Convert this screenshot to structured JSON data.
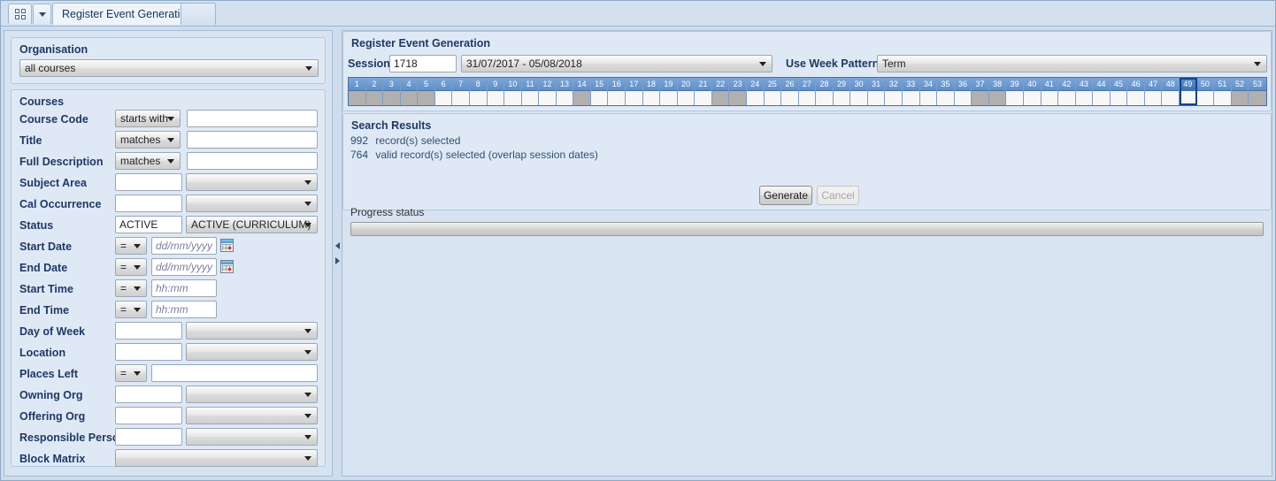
{
  "tabbar": {
    "grid_icon": "grid-icon",
    "menu_icon": "chevron-down-icon",
    "active_tab": "Register Event Generation",
    "empty_tab": ""
  },
  "left": {
    "organisation": {
      "title": "Organisation",
      "value": "all courses"
    },
    "courses": {
      "title": "Courses",
      "rows": [
        {
          "label": "Course Code",
          "op": "starts with",
          "type": "op-text",
          "value": ""
        },
        {
          "label": "Title",
          "op": "matches",
          "type": "op-text",
          "value": ""
        },
        {
          "label": "Full Description",
          "op": "matches",
          "type": "op-text",
          "value": ""
        },
        {
          "label": "Subject Area",
          "type": "text-combo",
          "value": "",
          "combo": ""
        },
        {
          "label": "Cal Occurrence",
          "type": "text-combo",
          "value": "",
          "combo": ""
        },
        {
          "label": "Status",
          "type": "text-combo",
          "value": "ACTIVE",
          "combo": "ACTIVE (CURRICULUM)"
        },
        {
          "label": "Start Date",
          "op": "=",
          "type": "date",
          "value": "",
          "placeholder": "dd/mm/yyyy"
        },
        {
          "label": "End Date",
          "op": "=",
          "type": "date",
          "value": "",
          "placeholder": "dd/mm/yyyy"
        },
        {
          "label": "Start Time",
          "op": "=",
          "type": "time",
          "value": "",
          "placeholder": "hh:mm"
        },
        {
          "label": "End Time",
          "op": "=",
          "type": "time",
          "value": "",
          "placeholder": "hh:mm"
        },
        {
          "label": "Day of Week",
          "type": "text-combo",
          "value": "",
          "combo": ""
        },
        {
          "label": "Location",
          "type": "text-combo",
          "value": "",
          "combo": ""
        },
        {
          "label": "Places Left",
          "op": "=",
          "type": "op-wide",
          "value": ""
        },
        {
          "label": "Owning Org",
          "type": "text-combo",
          "value": "",
          "combo": ""
        },
        {
          "label": "Offering Org",
          "type": "text-combo",
          "value": "",
          "combo": ""
        },
        {
          "label": "Responsible Person",
          "type": "text-combo",
          "value": "",
          "combo": ""
        },
        {
          "label": "Block Matrix",
          "type": "combo-only",
          "combo": ""
        }
      ]
    }
  },
  "splitter": {
    "collapse_icon": "arrow-left-icon",
    "expand_icon": "arrow-right-icon"
  },
  "right": {
    "register": {
      "title": "Register Event Generation",
      "session_label": "Session",
      "session_value": "1718",
      "session_range": "31/07/2017 - 05/08/2018",
      "week_pattern_label": "Use Week Pattern",
      "week_pattern_value": "Term",
      "weeks": [
        {
          "n": "1",
          "shaded": true,
          "selected": false
        },
        {
          "n": "2",
          "shaded": true,
          "selected": false
        },
        {
          "n": "3",
          "shaded": true,
          "selected": false
        },
        {
          "n": "4",
          "shaded": true,
          "selected": false
        },
        {
          "n": "5",
          "shaded": true,
          "selected": false
        },
        {
          "n": "6",
          "shaded": false,
          "selected": false
        },
        {
          "n": "7",
          "shaded": false,
          "selected": false
        },
        {
          "n": "8",
          "shaded": false,
          "selected": false
        },
        {
          "n": "9",
          "shaded": false,
          "selected": false
        },
        {
          "n": "10",
          "shaded": false,
          "selected": false
        },
        {
          "n": "11",
          "shaded": false,
          "selected": false
        },
        {
          "n": "12",
          "shaded": false,
          "selected": false
        },
        {
          "n": "13",
          "shaded": false,
          "selected": false
        },
        {
          "n": "14",
          "shaded": true,
          "selected": false
        },
        {
          "n": "15",
          "shaded": false,
          "selected": false
        },
        {
          "n": "16",
          "shaded": false,
          "selected": false
        },
        {
          "n": "17",
          "shaded": false,
          "selected": false
        },
        {
          "n": "18",
          "shaded": false,
          "selected": false
        },
        {
          "n": "19",
          "shaded": false,
          "selected": false
        },
        {
          "n": "20",
          "shaded": false,
          "selected": false
        },
        {
          "n": "21",
          "shaded": false,
          "selected": false
        },
        {
          "n": "22",
          "shaded": true,
          "selected": false
        },
        {
          "n": "23",
          "shaded": true,
          "selected": false
        },
        {
          "n": "24",
          "shaded": false,
          "selected": false
        },
        {
          "n": "25",
          "shaded": false,
          "selected": false
        },
        {
          "n": "26",
          "shaded": false,
          "selected": false
        },
        {
          "n": "27",
          "shaded": false,
          "selected": false
        },
        {
          "n": "28",
          "shaded": false,
          "selected": false
        },
        {
          "n": "29",
          "shaded": false,
          "selected": false
        },
        {
          "n": "30",
          "shaded": false,
          "selected": false
        },
        {
          "n": "31",
          "shaded": false,
          "selected": false
        },
        {
          "n": "32",
          "shaded": false,
          "selected": false
        },
        {
          "n": "33",
          "shaded": false,
          "selected": false
        },
        {
          "n": "34",
          "shaded": false,
          "selected": false
        },
        {
          "n": "35",
          "shaded": false,
          "selected": false
        },
        {
          "n": "36",
          "shaded": false,
          "selected": false
        },
        {
          "n": "37",
          "shaded": true,
          "selected": false
        },
        {
          "n": "38",
          "shaded": true,
          "selected": false
        },
        {
          "n": "39",
          "shaded": false,
          "selected": false
        },
        {
          "n": "40",
          "shaded": false,
          "selected": false
        },
        {
          "n": "41",
          "shaded": false,
          "selected": false
        },
        {
          "n": "42",
          "shaded": false,
          "selected": false
        },
        {
          "n": "43",
          "shaded": false,
          "selected": false
        },
        {
          "n": "44",
          "shaded": false,
          "selected": false
        },
        {
          "n": "45",
          "shaded": false,
          "selected": false
        },
        {
          "n": "46",
          "shaded": false,
          "selected": false
        },
        {
          "n": "47",
          "shaded": false,
          "selected": false
        },
        {
          "n": "48",
          "shaded": false,
          "selected": false
        },
        {
          "n": "49",
          "shaded": false,
          "selected": true
        },
        {
          "n": "50",
          "shaded": false,
          "selected": false
        },
        {
          "n": "51",
          "shaded": false,
          "selected": false
        },
        {
          "n": "52",
          "shaded": true,
          "selected": false
        },
        {
          "n": "53",
          "shaded": true,
          "selected": false
        }
      ]
    },
    "search_results": {
      "title": "Search Results",
      "records_count": "992",
      "records_text": "record(s) selected",
      "valid_count": "764",
      "valid_text": "valid record(s) selected (overlap session dates)",
      "generate_label": "Generate",
      "cancel_label": "Cancel",
      "progress_label": "Progress status",
      "progress_percent": 0
    }
  },
  "colors": {
    "accent": "#1f3864",
    "panel": "#dfe9f5",
    "window": "#cfdcec",
    "week_header": "#5e8fc9",
    "week_shaded": "#b0b0b0",
    "week_selected_border": "#12428f"
  }
}
